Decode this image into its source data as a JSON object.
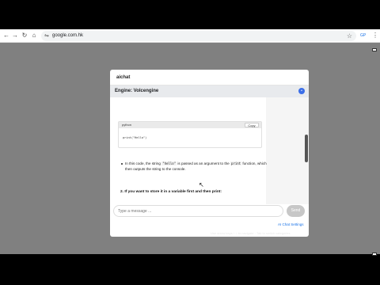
{
  "browser": {
    "url": "google.com.hk",
    "ext_label": "GP"
  },
  "panel": {
    "title": "aichat",
    "engine_label": "Engine: Volcengine",
    "engine_dot": "•"
  },
  "code_block": {
    "language": "python",
    "copy_label": "Copy",
    "code": "print(\"Hello\")"
  },
  "answer": {
    "bullet_prefix": "In this code, the string ",
    "bullet_code1": "\"hello\"",
    "bullet_middle": " is passed as an argument to the ",
    "bullet_code2": "print",
    "bullet_suffix": " function, which then outputs the string to the console.",
    "step_number": "2.",
    "step_text": "If you want to store it in a variable first and then print:"
  },
  "input": {
    "placeholder": "Type a message ...",
    "send_label": "Send"
  },
  "footer": {
    "settings_link": "AI Chat Settings",
    "hint": "Use arrow keys ↑ ↓ to navigate · Tab to switch categories"
  },
  "colors": {
    "accent": "#3b6ee8",
    "link": "#1a73e8",
    "page_bg": "#808080"
  }
}
